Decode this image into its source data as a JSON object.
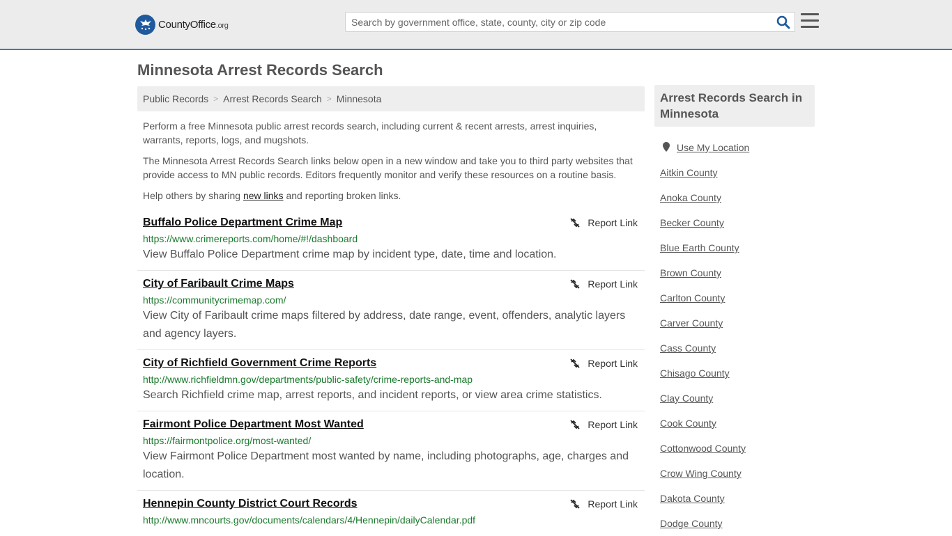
{
  "header": {
    "logo_text": "County",
    "logo_bold": "Office",
    "logo_suffix": ".org",
    "search_placeholder": "Search by government office, state, county, city or zip code"
  },
  "page": {
    "title": "Minnesota Arrest Records Search"
  },
  "breadcrumb": [
    "Public Records",
    "Arrest Records Search",
    "Minnesota"
  ],
  "intro": {
    "p1": "Perform a free Minnesota public arrest records search, including current & recent arrests, arrest inquiries, warrants, reports, logs, and mugshots.",
    "p2": "The Minnesota Arrest Records Search links below open in a new window and take you to third party websites that provide access to MN public records. Editors frequently monitor and verify these resources on a routine basis.",
    "p3_before": "Help others by sharing ",
    "p3_link": "new links",
    "p3_after": " and reporting broken links."
  },
  "report_label": "Report Link",
  "results": [
    {
      "title": "Buffalo Police Department Crime Map",
      "url": "https://www.crimereports.com/home/#!/dashboard",
      "desc": "View Buffalo Police Department crime map by incident type, date, time and location."
    },
    {
      "title": "City of Faribault Crime Maps",
      "url": "https://communitycrimemap.com/",
      "desc": "View City of Faribault crime maps filtered by address, date range, event, offenders, analytic layers and agency layers."
    },
    {
      "title": "City of Richfield Government Crime Reports",
      "url": "http://www.richfieldmn.gov/departments/public-safety/crime-reports-and-map",
      "desc": "Search Richfield crime map, arrest reports, and incident reports, or view area crime statistics."
    },
    {
      "title": "Fairmont Police Department Most Wanted",
      "url": "https://fairmontpolice.org/most-wanted/",
      "desc": "View Fairmont Police Department most wanted by name, including photographs, age, charges and location."
    },
    {
      "title": "Hennepin County District Court Records",
      "url": "http://www.mncourts.gov/documents/calendars/4/Hennepin/dailyCalendar.pdf",
      "desc": ""
    }
  ],
  "sidebar": {
    "heading": "Arrest Records Search in Minnesota",
    "use_location": "Use My Location",
    "counties": [
      "Aitkin County",
      "Anoka County",
      "Becker County",
      "Blue Earth County",
      "Brown County",
      "Carlton County",
      "Carver County",
      "Cass County",
      "Chisago County",
      "Clay County",
      "Cook County",
      "Cottonwood County",
      "Crow Wing County",
      "Dakota County",
      "Dodge County"
    ]
  },
  "colors": {
    "accent_border": "#3b7bbf",
    "url_green": "#1a7a2c",
    "logo_blue": "#1f5a9d",
    "search_icon_blue": "#1f5a9d"
  },
  "icons": {
    "search": "search-icon",
    "menu": "hamburger-menu-icon",
    "report": "broken-link-icon",
    "location": "map-pin-icon"
  }
}
